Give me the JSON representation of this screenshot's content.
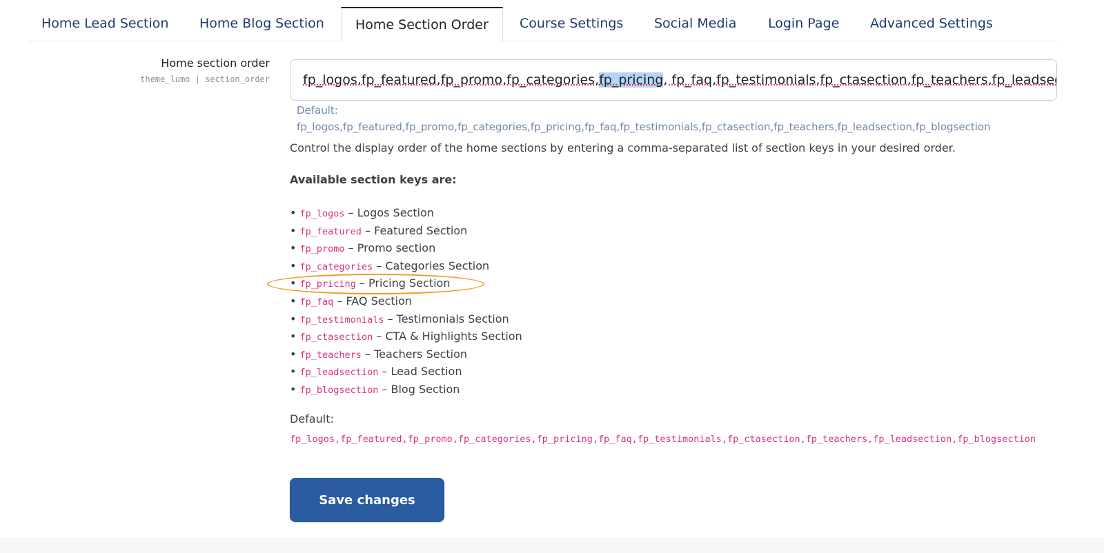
{
  "tabs": [
    {
      "label": "Home Lead Section",
      "active": false
    },
    {
      "label": "Home Blog Section",
      "active": false
    },
    {
      "label": "Home Section Order",
      "active": true
    },
    {
      "label": "Course Settings",
      "active": false
    },
    {
      "label": "Social Media",
      "active": false
    },
    {
      "label": "Login Page",
      "active": false
    },
    {
      "label": "Advanced Settings",
      "active": false
    }
  ],
  "field": {
    "label": "Home section order",
    "sub_label": "theme_lumo | section_order",
    "value_parts": {
      "before": "fp_logos,fp_featured,fp_promo,fp_categories,",
      "selected": "fp_pricing",
      "after": ", fp_faq,fp_testimonials,fp_ctasection,fp_teachers,fp_leadsection,fp_blogsection"
    },
    "default_label": "Default:",
    "default_value": "fp_logos,fp_featured,fp_promo,fp_categories,fp_pricing,fp_faq,fp_testimonials,fp_ctasection,fp_teachers,fp_leadsection,fp_blogsection"
  },
  "description": "Control the display order of the home sections by entering a comma-separated list of section keys in your desired order.",
  "available_heading": "Available section keys are:",
  "section_keys": [
    {
      "key": "fp_logos",
      "name": "– Logos Section"
    },
    {
      "key": "fp_featured",
      "name": "– Featured Section"
    },
    {
      "key": "fp_promo",
      "name": "– Promo section"
    },
    {
      "key": "fp_categories",
      "name": "– Categories Section"
    },
    {
      "key": "fp_pricing",
      "name": "– Pricing Section"
    },
    {
      "key": "fp_faq",
      "name": "– FAQ Section"
    },
    {
      "key": "fp_testimonials",
      "name": "– Testimonials Section"
    },
    {
      "key": "fp_ctasection",
      "name": "– CTA & Highlights Section"
    },
    {
      "key": "fp_teachers",
      "name": "– Teachers Section"
    },
    {
      "key": "fp_leadsection",
      "name": "– Lead Section"
    },
    {
      "key": "fp_blogsection",
      "name": "– Blog Section"
    }
  ],
  "defaults_block": {
    "label": "Default:",
    "value": "fp_logos,fp_featured,fp_promo,fp_categories,fp_pricing,fp_faq,fp_testimonials,fp_ctasection,fp_teachers,fp_leadsection,fp_blogsection"
  },
  "save_button": "Save changes",
  "colors": {
    "accent": "#2b5ba0",
    "code": "#d63384",
    "highlight_ellipse": "#f39a1e",
    "selection": "#b4d4f8"
  }
}
